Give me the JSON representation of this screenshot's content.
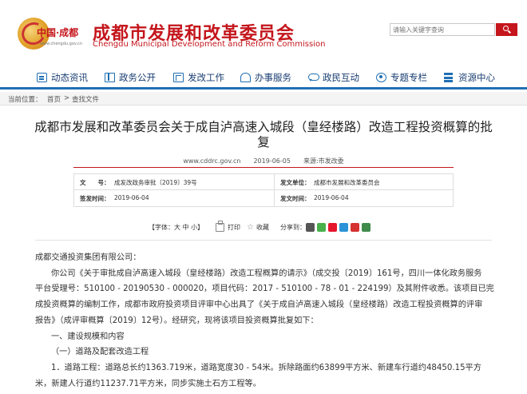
{
  "header": {
    "logo_text": "中国·成都",
    "logo_url": "www.chengdu.gov.cn",
    "title_cn": "成都市发展和改革委员会",
    "title_en": "Chengdu Municipal Development and Reform Commission",
    "brand_color": "#c4161c"
  },
  "search": {
    "placeholder": "请输入关键字查询"
  },
  "nav": {
    "items": [
      {
        "label": "动态资讯",
        "icon": "news-icon"
      },
      {
        "label": "政务公开",
        "icon": "document-icon"
      },
      {
        "label": "发改工作",
        "icon": "edit-icon"
      },
      {
        "label": "办事服务",
        "icon": "service-icon"
      },
      {
        "label": "政民互动",
        "icon": "chat-icon"
      },
      {
        "label": "专题专栏",
        "icon": "topic-icon"
      },
      {
        "label": "资源中心",
        "icon": "resource-icon"
      }
    ]
  },
  "breadcrumb": {
    "label": "当前位置：",
    "home": "首页",
    "sep": ">",
    "current": "查找文件"
  },
  "article": {
    "title": "成都市发展和改革委员会关于成自泸高速入城段（皇经楼路）改造工程投资概算的批复",
    "meta": "www.cddrc.gov.cn　　2019-06-05　　来源:市发改委",
    "info": {
      "wenhao_label": "文　　号：",
      "wenhao": "成发改政务审批〔2019〕39号",
      "unit_label": "发文单位：",
      "unit": "成都市发展和改革委员会",
      "date_label": "签发时间：",
      "date": "2019-06-04",
      "pub_label": "发文时间：",
      "pub": "2019-06-04"
    },
    "tools": {
      "font": "【字体：大 中 小】",
      "print": "打印",
      "fav": "收藏",
      "share": "分享到："
    },
    "body": {
      "p0": "成都交通投资集团有限公司：",
      "p1a": "你公司《关于审批成自泸高速入城段（皇经楼路）改造工程概算的请示》（成交投〔2019〕161号，四川一体化政务服务",
      "p1b": "平台受理号：510100 - 20190530 - 000020，项目代码：2017 - 510100 - 78 - 01 - 224199）及其附件收悉。该项目已完",
      "p1c": "成投资概算的编制工作，成都市政府投资项目评审中心出具了《关于成自泸高速入城段（皇经楼路）改造工程投资概算的评审",
      "p1d": "报告》（成评审概算〔2019〕12号）。经研究，现将该项目投资概算批复如下：",
      "p2": "一、建设规模和内容",
      "p3": "（一）道路及配套改造工程",
      "p4a": "1．道路工程：道路总长约1363.719米，道路宽度30 - 54米。拆除路面约63899平方米、新建车行道约48450.15平方",
      "p4b": "米，新建人行道约11237.71平方米，同步实施土石方工程等。"
    }
  }
}
